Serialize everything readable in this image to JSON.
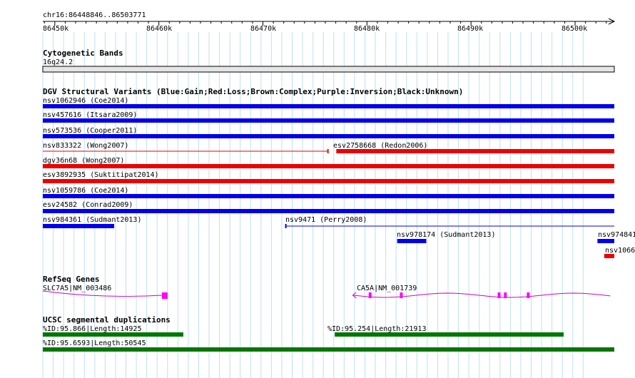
{
  "ruler": {
    "position": "chr16:86448846..86503771",
    "start": 86448846,
    "end": 86503771,
    "ticks": [
      "86450k",
      "86460k",
      "86470k",
      "86480k",
      "86490k",
      "86500k"
    ]
  },
  "cytoband": {
    "title": "Cytogenetic Bands",
    "band_label": "16q24.2"
  },
  "dgv": {
    "title": "DGV Structural Variants (Blue:Gain;Red:Loss;Brown:Complex;Purple:Inversion;Black:Unknown)",
    "features": [
      {
        "label": "nsv1062946 (Coe2014)",
        "type": "gain",
        "start": 86448846,
        "end": 86503771
      },
      {
        "label": "nsv457616 (Itsara2009)",
        "type": "gain",
        "start": 86448846,
        "end": 86503771
      },
      {
        "label": "nsv573536 (Cooper2011)",
        "type": "gain",
        "start": 86448846,
        "end": 86503771
      },
      {
        "label": "nsv833322 (Wong2007)",
        "type": "loss_thin",
        "start": 86448846,
        "end": 86476250
      },
      {
        "label": "esv2758668 (Redon2006)",
        "type": "loss",
        "start": 86477050,
        "end": 86503771
      },
      {
        "label": "dgv36n68 (Wong2007)",
        "type": "loss",
        "start": 86448846,
        "end": 86503771
      },
      {
        "label": "esv3892935 (Suktitipat2014)",
        "type": "loss",
        "start": 86448846,
        "end": 86503771
      },
      {
        "label": "nsv1059786 (Coe2014)",
        "type": "gain",
        "start": 86448846,
        "end": 86503771
      },
      {
        "label": "esv24582 (Conrad2009)",
        "type": "gain",
        "start": 86448846,
        "end": 86503771
      },
      {
        "label": "nsv984361 (Sudmant2013)",
        "type": "gain",
        "start": 86448846,
        "end": 86455700
      },
      {
        "label": "nsv9471 (Perry2008)",
        "type": "gain_thin",
        "start": 86472200,
        "end": 86503771
      },
      {
        "label": "nsv978174 (Sudmant2013)",
        "type": "gain",
        "start": 86482900,
        "end": 86485700
      },
      {
        "label": "nsv974841",
        "type": "gain",
        "start": 86502150,
        "end": 86503771
      },
      {
        "label": "nsv1066",
        "type": "loss",
        "start": 86502800,
        "end": 86503771
      }
    ]
  },
  "refseq": {
    "title": "RefSeq Genes",
    "genes": [
      {
        "label": "SLC7A5|NM_003486",
        "strand": "-",
        "start": 86448846,
        "end": 86460700
      },
      {
        "label": "CA5A|NM_001739",
        "strand": "-",
        "start": 86478700,
        "end": 86503771
      }
    ]
  },
  "segdups": {
    "title": "UCSC segmental duplications",
    "items": [
      {
        "label": "%ID:95.866|Length:14925",
        "start": 86448846,
        "end": 86462350
      },
      {
        "label": "%ID:95.254|Length:21913",
        "start": 86476900,
        "end": 86498900
      },
      {
        "label": "%ID:95.6593|Length:50545",
        "start": 86448846,
        "end": 86503771
      }
    ]
  },
  "colors": {
    "gain": "#0000ee",
    "loss": "#ee0000",
    "gene": "#d000d0",
    "gene_exon": "#ff00ff",
    "segdup": "#007700",
    "grid": "#bfe0f0",
    "cytoband_fill": "#e6e6e6"
  }
}
